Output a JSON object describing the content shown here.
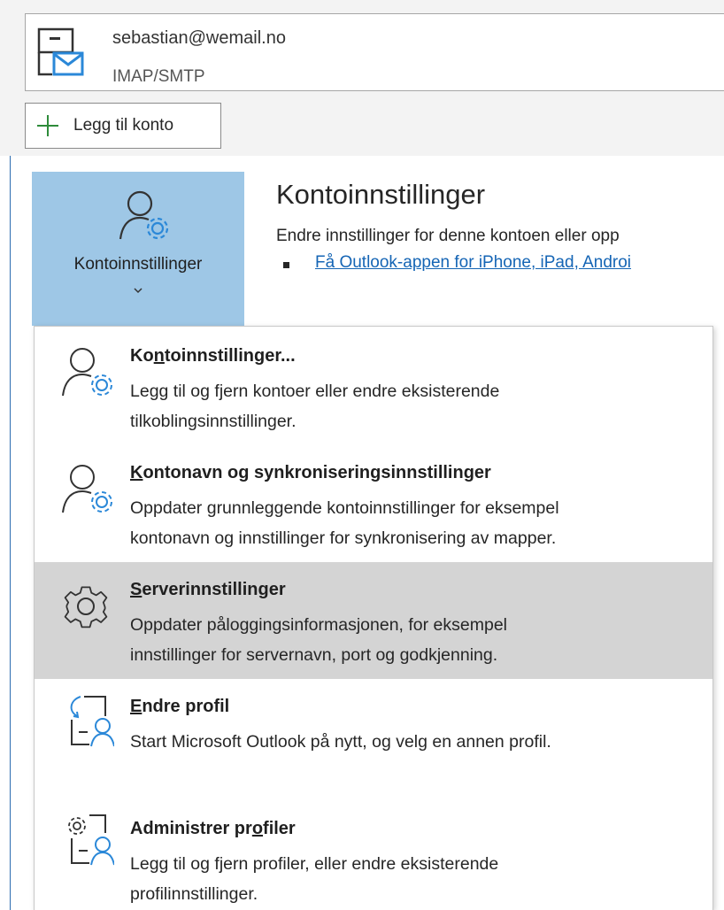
{
  "account": {
    "email": "sebastian@wemail.no",
    "type": "IMAP/SMTP",
    "icon": "mail-account-icon"
  },
  "add_account": {
    "label": "Legg til konto",
    "icon": "plus-icon"
  },
  "account_settings_button": {
    "label": "Kontoinnstillinger",
    "icon": "person-gear-icon"
  },
  "header": {
    "title": "Kontoinnstillinger",
    "description": "Endre innstillinger for denne kontoen eller opp",
    "link": "Få Outlook-appen for iPhone, iPad, Androi"
  },
  "menu": {
    "items": [
      {
        "title_pre": "Ko",
        "title_acc": "n",
        "title_post": "toinnstillinger...",
        "desc_line1": "Legg til og fjern kontoer eller endre eksisterende",
        "desc_line2": "tilkoblingsinnstillinger.",
        "icon": "person-gear-icon"
      },
      {
        "title_pre": "",
        "title_acc": "K",
        "title_post": "ontonavn og synkroniseringsinnstillinger",
        "desc_line1": "Oppdater grunnleggende kontoinnstillinger for eksempel",
        "desc_line2": "kontonavn og innstillinger for synkronisering av mapper.",
        "icon": "person-gear-icon"
      },
      {
        "title_pre": "",
        "title_acc": "S",
        "title_post": "erverinnstillinger",
        "desc_line1": "Oppdater påloggingsinformasjonen, for eksempel",
        "desc_line2": "innstillinger for servernavn, port og godkjenning.",
        "icon": "gear-icon"
      },
      {
        "title_pre": "",
        "title_acc": "E",
        "title_post": "ndre profil",
        "desc_line1": "Start Microsoft Outlook på nytt, og velg en annen profil.",
        "desc_line2": "",
        "icon": "switch-profile-icon"
      },
      {
        "title_pre": "Administrer pr",
        "title_acc": "o",
        "title_post": "filer",
        "desc_line1": "Legg til og fjern profiler, eller endre eksisterende",
        "desc_line2": "profilinnstillinger.",
        "icon": "manage-profiles-icon"
      }
    ]
  },
  "colors": {
    "accent_button": "#9ec7e6",
    "link": "#1565b5",
    "highlight": "#d4d4d4",
    "plus_green": "#2e8b3a",
    "icon_blue": "#2b88d8"
  }
}
